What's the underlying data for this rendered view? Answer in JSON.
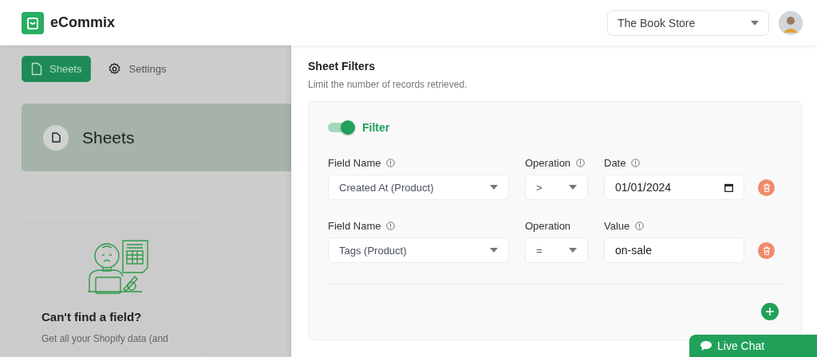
{
  "header": {
    "brand": "eCommix",
    "store_select": "The Book Store"
  },
  "nav": {
    "tabs": [
      {
        "label": "Sheets",
        "selected": true
      },
      {
        "label": "Settings",
        "selected": false
      }
    ]
  },
  "page_card": {
    "title": "Sheets"
  },
  "help_card": {
    "title": "Can't find a field?",
    "text": "Get all your Shopify data (and"
  },
  "drawer": {
    "title": "Sheet Filters",
    "subtitle": "Limit the number of records retrieved.",
    "filter_toggle": {
      "label": "Filter",
      "on": true
    },
    "rows": [
      {
        "kind": "date",
        "field_label": {
          "text": "Field Name",
          "info": true
        },
        "field_value": "Created At (Product)",
        "operation_label": {
          "text": "Operation",
          "info": true
        },
        "operation_value": ">",
        "value_label": {
          "text": "Date",
          "info": true
        },
        "value": "01/01/2024"
      },
      {
        "kind": "text",
        "field_label": {
          "text": "Field Name",
          "info": true
        },
        "field_value": "Tags (Product)",
        "operation_label": {
          "text": "Operation",
          "info": false
        },
        "operation_value": "=",
        "value_label": {
          "text": "Value",
          "info": true
        },
        "value": "on-sale"
      }
    ]
  },
  "live_chat": "Live Chat"
}
